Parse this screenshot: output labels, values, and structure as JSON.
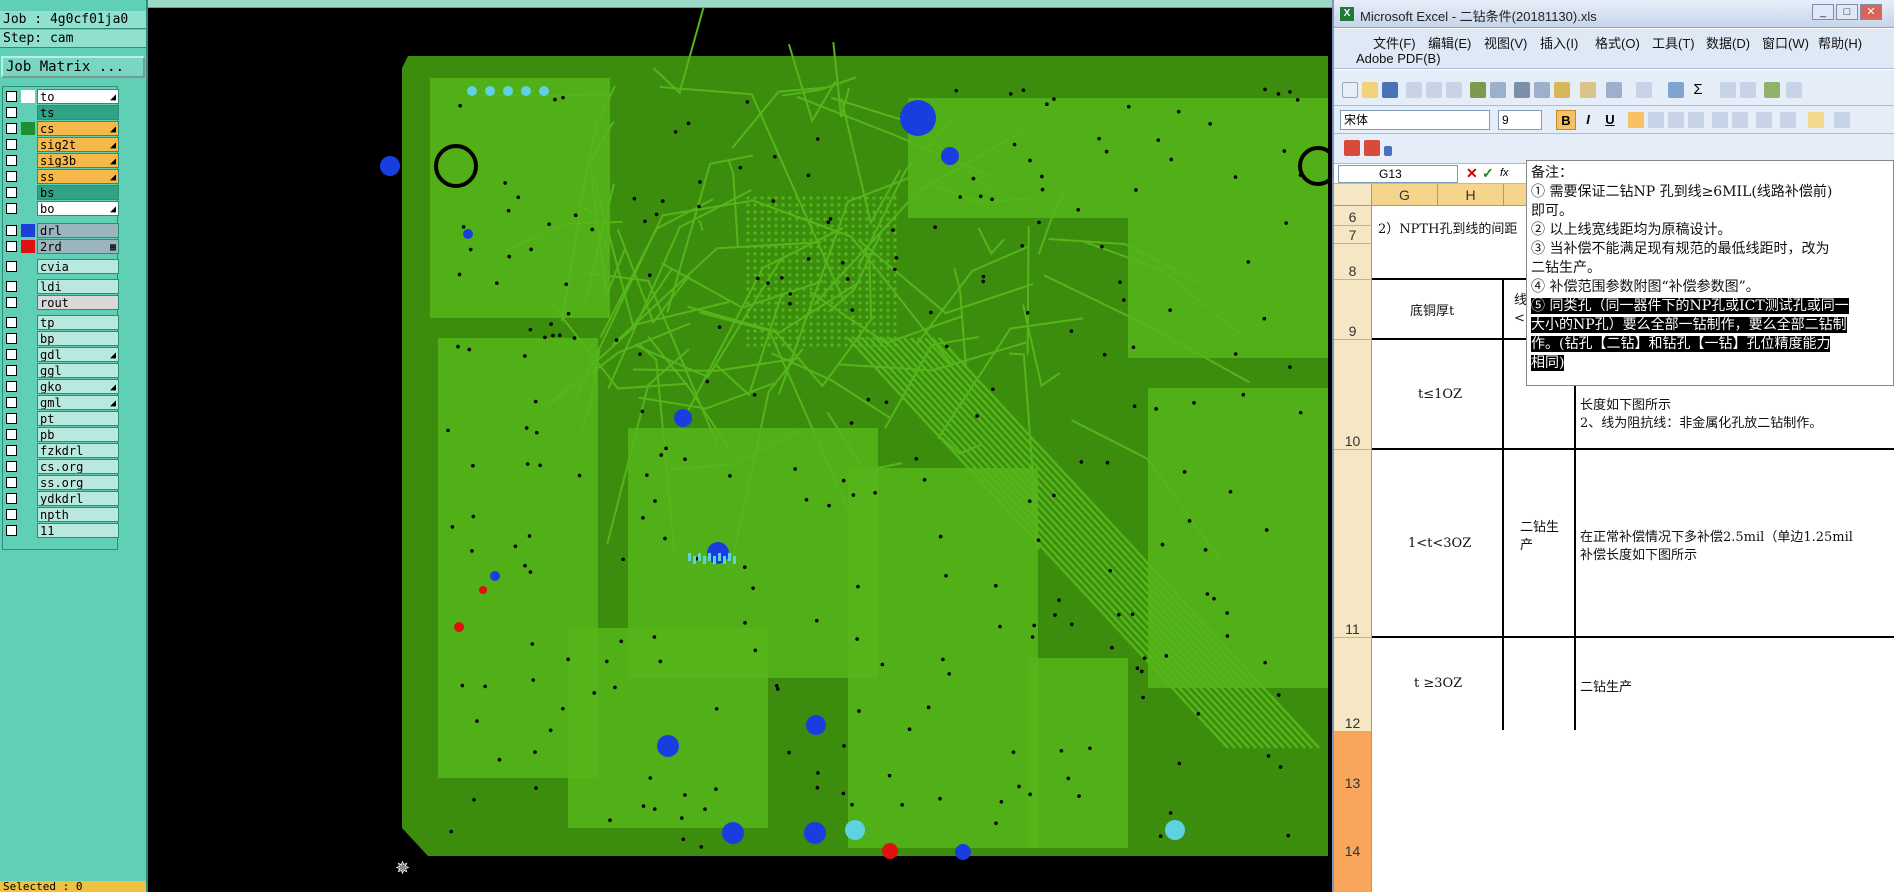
{
  "cam": {
    "job_label": "Job : 4g0cf01ja0",
    "step_label": "Step: cam",
    "job_matrix_label": "Job Matrix ...",
    "selected_label": "Selected : 0",
    "layers": [
      {
        "name": "to",
        "bg": "#ffffff",
        "swatch": "#ffffff",
        "mark": "◢"
      },
      {
        "name": "ts",
        "bg": "#2fa383",
        "swatch": "#5fcfb5",
        "mark": ""
      },
      {
        "name": "cs",
        "bg": "#f7b84a",
        "swatch": "#1e8f2e",
        "mark": "◢"
      },
      {
        "name": "sig2t",
        "bg": "#f7b84a",
        "swatch": "#5fcfb5",
        "mark": "◢"
      },
      {
        "name": "sig3b",
        "bg": "#f7b84a",
        "swatch": "#5fcfb5",
        "mark": "◢"
      },
      {
        "name": "ss",
        "bg": "#f7b84a",
        "swatch": "#5fcfb5",
        "mark": "◢"
      },
      {
        "name": "bs",
        "bg": "#2fa383",
        "swatch": "#5fcfb5",
        "mark": ""
      },
      {
        "name": "bo",
        "bg": "#ffffff",
        "swatch": "#5fcfb5",
        "mark": "◢"
      },
      {
        "name": "drl",
        "bg": "#9bb4be",
        "swatch": "#1e3fd8",
        "mark": ""
      },
      {
        "name": "2rd",
        "bg": "#9bb4be",
        "swatch": "#e01010",
        "mark": "▦"
      },
      {
        "name": "cvia",
        "bg": "#b9e8de",
        "swatch": "#5fcfb5",
        "mark": ""
      },
      {
        "name": "ldi",
        "bg": "#b9e8de",
        "swatch": "#5fcfb5",
        "mark": ""
      },
      {
        "name": "rout",
        "bg": "#d8d8d8",
        "swatch": "#5fcfb5",
        "mark": ""
      },
      {
        "name": "tp",
        "bg": "#b9e8de",
        "swatch": "#5fcfb5",
        "mark": ""
      },
      {
        "name": "bp",
        "bg": "#b9e8de",
        "swatch": "#5fcfb5",
        "mark": ""
      },
      {
        "name": "gdl",
        "bg": "#b9e8de",
        "swatch": "#5fcfb5",
        "mark": "◢"
      },
      {
        "name": "ggl",
        "bg": "#b9e8de",
        "swatch": "#5fcfb5",
        "mark": ""
      },
      {
        "name": "gko",
        "bg": "#b9e8de",
        "swatch": "#5fcfb5",
        "mark": "◢"
      },
      {
        "name": "gml",
        "bg": "#b9e8de",
        "swatch": "#5fcfb5",
        "mark": "◢"
      },
      {
        "name": "pt",
        "bg": "#b9e8de",
        "swatch": "#5fcfb5",
        "mark": ""
      },
      {
        "name": "pb",
        "bg": "#b9e8de",
        "swatch": "#5fcfb5",
        "mark": ""
      },
      {
        "name": "fzkdrl",
        "bg": "#b9e8de",
        "swatch": "#5fcfb5",
        "mark": ""
      },
      {
        "name": "cs.org",
        "bg": "#b9e8de",
        "swatch": "#5fcfb5",
        "mark": ""
      },
      {
        "name": "ss.org",
        "bg": "#b9e8de",
        "swatch": "#5fcfb5",
        "mark": ""
      },
      {
        "name": "ydkdrl",
        "bg": "#b9e8de",
        "swatch": "#5fcfb5",
        "mark": ""
      },
      {
        "name": "npth",
        "bg": "#b9e8de",
        "swatch": "#5fcfb5",
        "mark": ""
      },
      {
        "name": "11",
        "bg": "#b9e8de",
        "swatch": "#5fcfb5",
        "mark": ""
      }
    ]
  },
  "colors": {
    "board": "#3c8d0e",
    "trace": "#55b51a",
    "drill_blue": "#1a3de0",
    "drill_red": "#e01010",
    "pad_cyan": "#5ed2e0"
  },
  "excel": {
    "title": "Microsoft Excel - 二钻条件(20181130).xls",
    "menu": [
      "文件(F)",
      "编辑(E)",
      "视图(V)",
      "插入(I)",
      "格式(O)",
      "工具(T)",
      "数据(D)",
      "窗口(W)",
      "帮助(H)"
    ],
    "adobe_menu": "Adobe PDF(B)",
    "font_name": "宋体",
    "font_size": "9",
    "bold": "B",
    "italic": "I",
    "underline": "U",
    "name_box": "G13",
    "fx": "fx",
    "columns": [
      "G",
      "H",
      ""
    ],
    "rows": [
      "6",
      "7",
      "8",
      "9",
      "10",
      "11",
      "12",
      "13",
      "14"
    ],
    "cells": {
      "r6": "2）NPTH孔到线的间距",
      "r9_g": "底铜厚t",
      "r9_h": "线\n<=",
      "r10_g": "t≤1OZ",
      "r10_i1": "长度如下图所示",
      "r10_i2": "2、线为阻抗线：非金属化孔放二钻制作。",
      "r11_g": "1<t<3OZ",
      "r11_h": "二钻生\n产",
      "r11_i1": "在正常补偿情况下多补偿2.5mil（单边1.25mil",
      "r11_i2": "补偿长度如下图所示",
      "r12_g": "t ≥3OZ",
      "r12_i": "二钻生产"
    },
    "comment": {
      "title": "备注：",
      "l1": "① 需要保证二钻NP 孔到线≥6MIL(线路补偿前)",
      "l1b": "即可。",
      "l2": "② 以上线宽线距均为原稿设计。",
      "l3": "③ 当补偿不能满足现有规范的最低线距时，改为",
      "l3b": "二钻生产。",
      "l4": "④ 补偿范围参数附图“补偿参数图”。",
      "l5a": "⑤ 同类孔（同一器件下的NP孔或ICT测试孔或同一",
      "l5b": "大小的NP孔）要么全部一钻制作，要么全部二钻制",
      "l5c": "作。(钻孔【二钻】和钻孔【一钻】孔位精度能力",
      "l5d": "相同)"
    }
  }
}
